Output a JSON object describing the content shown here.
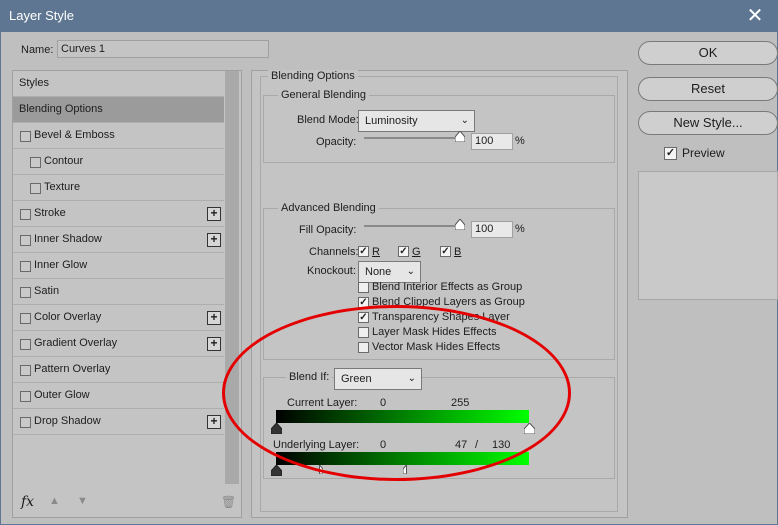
{
  "window": {
    "title": "Layer Style",
    "close_glyph": "✕"
  },
  "name_field": {
    "label": "Name:",
    "value": "Curves 1"
  },
  "styles_list": {
    "items": [
      {
        "label": "Styles",
        "type": "header",
        "checkbox": false,
        "plus": false
      },
      {
        "label": "Blending Options",
        "type": "selected",
        "checkbox": false,
        "plus": false
      },
      {
        "label": "Bevel & Emboss",
        "type": "item",
        "checkbox": true,
        "plus": false
      },
      {
        "label": "Contour",
        "type": "sub",
        "checkbox": true,
        "plus": false
      },
      {
        "label": "Texture",
        "type": "sub",
        "checkbox": true,
        "plus": false
      },
      {
        "label": "Stroke",
        "type": "item",
        "checkbox": true,
        "plus": true
      },
      {
        "label": "Inner Shadow",
        "type": "item",
        "checkbox": true,
        "plus": true
      },
      {
        "label": "Inner Glow",
        "type": "item",
        "checkbox": true,
        "plus": false
      },
      {
        "label": "Satin",
        "type": "item",
        "checkbox": true,
        "plus": false
      },
      {
        "label": "Color Overlay",
        "type": "item",
        "checkbox": true,
        "plus": true
      },
      {
        "label": "Gradient Overlay",
        "type": "item",
        "checkbox": true,
        "plus": true
      },
      {
        "label": "Pattern Overlay",
        "type": "item",
        "checkbox": true,
        "plus": false
      },
      {
        "label": "Outer Glow",
        "type": "item",
        "checkbox": true,
        "plus": false
      },
      {
        "label": "Drop Shadow",
        "type": "item",
        "checkbox": true,
        "plus": true
      }
    ],
    "plus_glyph": "+",
    "bottom": {
      "fx_label": "fx",
      "up_glyph": "▲",
      "down_glyph": "▼",
      "trash_glyph": "🗑"
    }
  },
  "blending": {
    "title": "Blending Options",
    "general": {
      "title": "General Blending",
      "blend_mode_label": "Blend Mode:",
      "blend_mode_value": "Luminosity",
      "opacity_label": "Opacity:",
      "opacity_value": "100",
      "percent": "%"
    },
    "advanced": {
      "title": "Advanced Blending",
      "fill_opacity_label": "Fill Opacity:",
      "fill_opacity_value": "100",
      "percent": "%",
      "channels_label": "Channels:",
      "channels": [
        {
          "label": "R",
          "checked": true
        },
        {
          "label": "G",
          "checked": true
        },
        {
          "label": "B",
          "checked": true
        }
      ],
      "knockout_label": "Knockout:",
      "knockout_value": "None",
      "options": [
        {
          "label": "Blend Interior Effects as Group",
          "checked": false
        },
        {
          "label": "Blend Clipped Layers as Group",
          "checked": true
        },
        {
          "label": "Transparency Shapes Layer",
          "checked": true
        },
        {
          "label": "Layer Mask Hides Effects",
          "checked": false
        },
        {
          "label": "Vector Mask Hides Effects",
          "checked": false
        }
      ]
    },
    "blend_if": {
      "label": "Blend If:",
      "value": "Green",
      "current_layer_label": "Current Layer:",
      "current_min": "0",
      "current_max": "255",
      "underlying_label": "Underlying Layer:",
      "underlying_min": "0",
      "underlying_split_low": "47",
      "separator": "/",
      "underlying_split_high": "130"
    }
  },
  "buttons": {
    "ok": "OK",
    "reset": "Reset",
    "new_style": "New Style..."
  },
  "preview": {
    "label": "Preview",
    "checked": true
  },
  "colors": {
    "title_bar": "#5e7691",
    "dialog_bg": "#bfbfbf",
    "annotation": "#e40000",
    "gradient_end": "#00ff00"
  }
}
